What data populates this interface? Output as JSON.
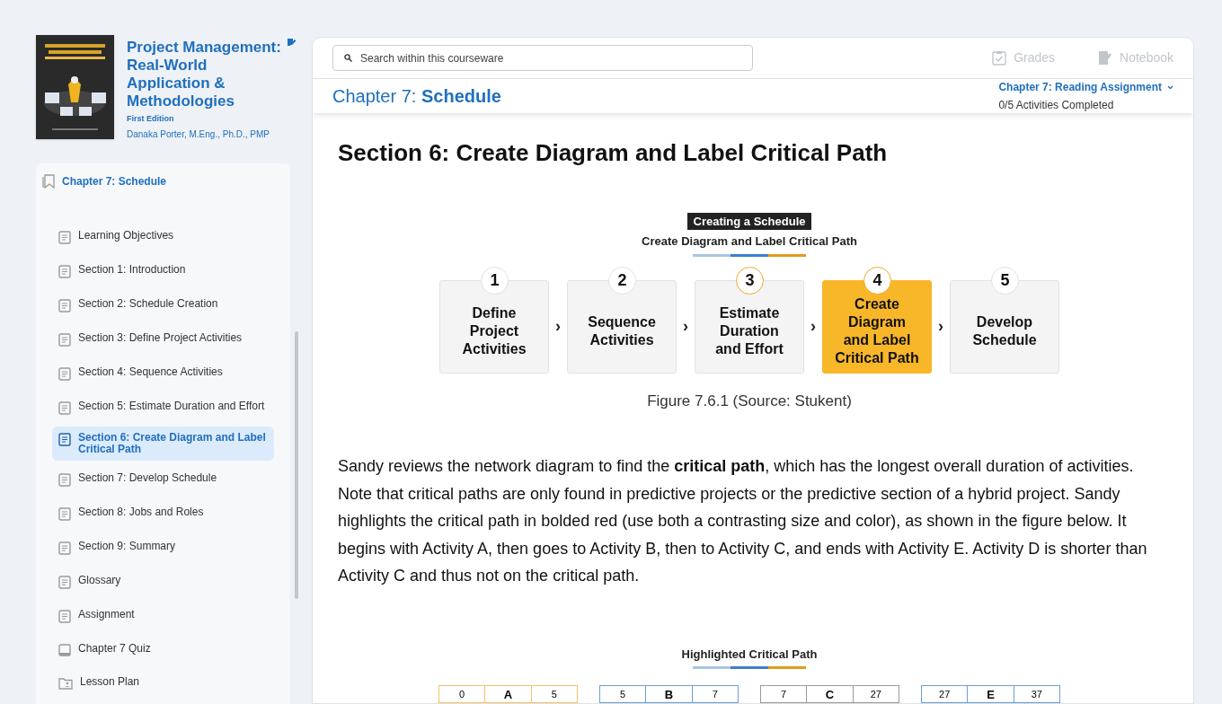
{
  "book": {
    "title": "Project Management: Real-World Application & Methodologies",
    "edition": "First Edition",
    "author": "Danaka Porter, M.Eng., Ph.D., PMP"
  },
  "sidebar": {
    "chapter": "Chapter 7: Schedule",
    "items": [
      {
        "label": "Learning Objectives",
        "kind": "page",
        "selected": false
      },
      {
        "label": "Section 1: Introduction",
        "kind": "page",
        "selected": false
      },
      {
        "label": "Section 2: Schedule Creation",
        "kind": "page",
        "selected": false
      },
      {
        "label": "Section 3: Define Project Activities",
        "kind": "page",
        "selected": false
      },
      {
        "label": "Section 4: Sequence Activities",
        "kind": "page",
        "selected": false
      },
      {
        "label": "Section 5: Estimate Duration and Effort",
        "kind": "page",
        "selected": false
      },
      {
        "label": "Section 6: Create Diagram and Label Critical Path",
        "kind": "page",
        "selected": true
      },
      {
        "label": "Section 7: Develop Schedule",
        "kind": "page",
        "selected": false
      },
      {
        "label": "Section 8: Jobs and Roles",
        "kind": "page",
        "selected": false
      },
      {
        "label": "Section 9: Summary",
        "kind": "page",
        "selected": false
      },
      {
        "label": "Glossary",
        "kind": "page",
        "selected": false
      },
      {
        "label": "Assignment",
        "kind": "page",
        "selected": false
      },
      {
        "label": "Chapter 7 Quiz",
        "kind": "quiz",
        "selected": false
      },
      {
        "label": "Lesson Plan",
        "kind": "plan",
        "selected": false
      }
    ]
  },
  "toolbar": {
    "search": {
      "placeholder": "Search within this courseware"
    },
    "buttons": [
      {
        "label": "Grades",
        "kind": "grades",
        "disabled": true
      },
      {
        "label": "Notebook",
        "kind": "notebook",
        "disabled": true
      }
    ]
  },
  "header": {
    "title": "Chapter 7: **Schedule**",
    "assignment": "Chapter 7: Reading Assignment",
    "progress": "0/5 Activities Completed"
  },
  "content": {
    "heading": "Section 6: Create Diagram and Label Critical Path",
    "figure": {
      "badge": "Creating a Schedule",
      "subtitle": "Create Diagram and Label Critical Path",
      "steps": [
        {
          "number": "1",
          "label": "Define\nProject\nActivities",
          "ringed": false,
          "selected": false
        },
        {
          "number": "2",
          "label": "Sequence\nActivities",
          "ringed": false,
          "selected": false
        },
        {
          "number": "3",
          "label": "Estimate\nDuration\nand Effort",
          "ringed": true,
          "selected": false
        },
        {
          "number": "4",
          "label": "Create Diagram\nand Label\nCritical Path",
          "ringed": true,
          "selected": true
        },
        {
          "number": "5",
          "label": "Develop\nSchedule",
          "ringed": false,
          "selected": false
        }
      ],
      "separator": "›",
      "caption": "Figure 7.6.1 (Source: Stukent)"
    },
    "paragraph": "Sandy reviews the network diagram to find the **critical path**, which has the longest overall duration of activities. Note that critical paths are only found in predictive projects or the predictive section of a hybrid project. Sandy highlights the critical path in bolded red (use both a contrasting size and color), as shown in the figure below. It begins with Activity A, then goes to Activity B, then to Activity C, and ends with Activity E. Activity D is shorter than Activity C and thus not on the critical path.",
    "figure2": {
      "title": "Highlighted Critical Path",
      "nodes": [
        {
          "start": "0",
          "name": "A",
          "finish": "5",
          "color": "#f5c26b"
        },
        {
          "start": "5",
          "name": "B",
          "finish": "7",
          "color": "#6a9fd8"
        },
        {
          "start": "7",
          "name": "C",
          "finish": "27",
          "color": "#9a9a9a"
        },
        {
          "start": "27",
          "name": "E",
          "finish": "37",
          "color": "#6a9fd8"
        }
      ]
    }
  }
}
